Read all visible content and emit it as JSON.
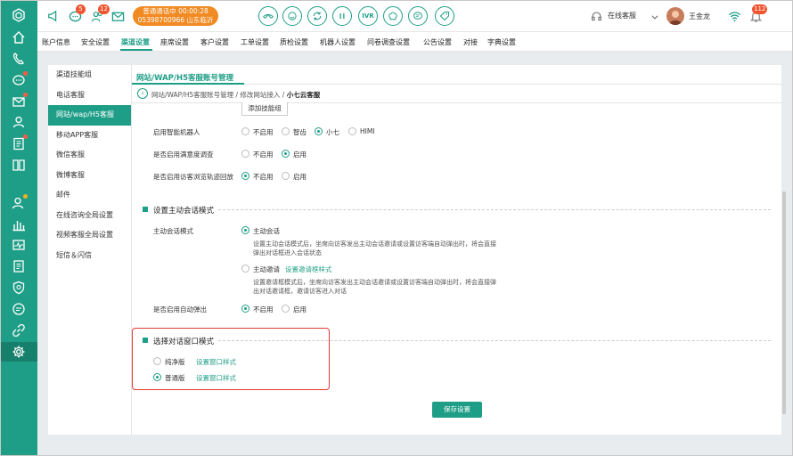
{
  "topbar": {
    "chat_badge": "5",
    "user_badge": "12",
    "call_status": "普通通话中  00:00:28",
    "call_number": "05398700966 山东临沂",
    "ivr_label": "IVR",
    "agent_status": "在线客服",
    "user_name": "王金龙",
    "notify_badge": "112"
  },
  "nav": {
    "items": [
      "账户信息",
      "安全设置",
      "渠道设置",
      "座席设置",
      "客户设置",
      "工单设置",
      "质检设置",
      "机器人设置",
      "问卷调查设置",
      "公告设置",
      "对接",
      "字典设置"
    ]
  },
  "left_menu": {
    "items": [
      "渠道技能组",
      "电话客服",
      "网站/wap/H5客服",
      "移动APP客服",
      "微信客服",
      "微博客服",
      "邮件",
      "在线咨询全局设置",
      "视频客服全局设置",
      "短信＆闪信"
    ]
  },
  "page": {
    "title": "网站/WAP/H5客服账号管理",
    "breadcrumb": "网站/WAP/H5客服账号管理 / 修改网站接入 / ",
    "breadcrumb_current": "小七云客服",
    "add_skill_group": "添加技能组"
  },
  "form": {
    "robot_label": "启用智能机器人",
    "robot_options": [
      "不启用",
      "智齿",
      "小七",
      "HIMI"
    ],
    "robot_selected": "小七",
    "survey_label": "是否启用满意度调查",
    "survey_options": [
      "不启用",
      "启用"
    ],
    "survey_selected": "启用",
    "track_label": "是否启用访客浏览轨迹回放",
    "track_options": [
      "不启用",
      "启用"
    ],
    "track_selected": "不启用"
  },
  "active_section": {
    "title": "设置主动会话模式",
    "mode_label": "主动会话模式",
    "option1": "主动会话",
    "option1_desc_line1": "设置主动会话模式后，坐席向访客发出主动会话邀请或设置访客端自动弹出时，将会直接",
    "option1_desc_line2": "弹出对话框进入会话状态",
    "option2": "主动邀请",
    "option2_link": "设置邀请框样式",
    "option2_desc_line1": "设置邀请框模式后，坐席向访客发出主动会话邀请或设置访客端自动弹出时，将会直接弹",
    "option2_desc_line2": "出对话邀请框，邀请访客进入对话",
    "auto_popup_label": "是否启用自动弹出",
    "auto_popup_options": [
      "不启用",
      "启用"
    ],
    "auto_popup_selected": "不启用"
  },
  "window_section": {
    "title": "选择对话窗口模式",
    "option1": "纯净版",
    "option1_link": "设置窗口样式",
    "option2": "普通版",
    "option2_link": "设置窗口样式",
    "selected": "普通版"
  },
  "save_button": "保存设置",
  "colors": {
    "accent": "#1f9e87",
    "call": "#f18a22",
    "highlight": "#e53935"
  }
}
